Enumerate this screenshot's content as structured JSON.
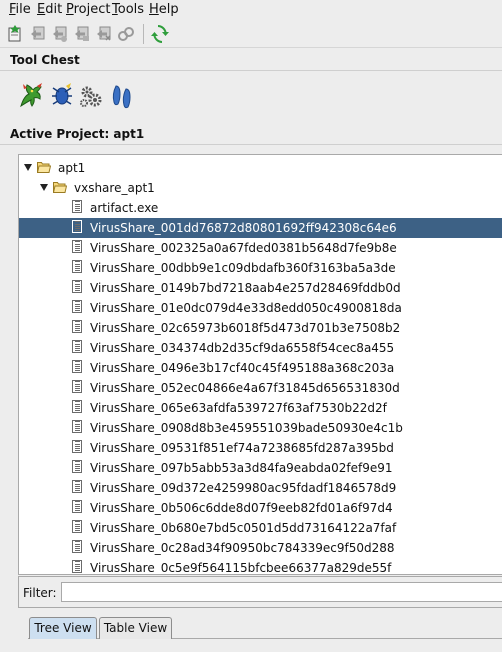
{
  "menu": {
    "items": [
      {
        "mnemonic": "F",
        "rest": "ile"
      },
      {
        "mnemonic": "E",
        "rest": "dit"
      },
      {
        "mnemonic": "P",
        "rest": "roject"
      },
      {
        "mnemonic": "T",
        "rest": "ools"
      },
      {
        "mnemonic": "H",
        "rest": "elp"
      }
    ]
  },
  "toolbar": {
    "icons": [
      "new-project-icon",
      "open-project-icon",
      "import-icon",
      "export-icon",
      "archive-icon",
      "link-icon",
      "refresh-icon"
    ]
  },
  "tool_chest": {
    "title": "Tool Chest",
    "tools": [
      "dragon-icon",
      "debugger-bug-icon",
      "version-tracking-gears-icon",
      "footprints-icon"
    ]
  },
  "project": {
    "title": "Active Project: apt1",
    "root": "apt1",
    "folder": "vxshare_apt1",
    "files": [
      "artifact.exe",
      "VirusShare_001dd76872d80801692ff942308c64e6",
      "VirusShare_002325a0a67fded0381b5648d7fe9b8e",
      "VirusShare_00dbb9e1c09dbdafb360f3163ba5a3de",
      "VirusShare_0149b7bd7218aab4e257d28469fddb0d",
      "VirusShare_01e0dc079d4e33d8edd050c4900818da",
      "VirusShare_02c65973b6018f5d473d701b3e7508b2",
      "VirusShare_034374db2d35cf9da6558f54cec8a455",
      "VirusShare_0496e3b17cf40c45f495188a368c203a",
      "VirusShare_052ec04866e4a67f31845d656531830d",
      "VirusShare_065e63afdfa539727f63af7530b22d2f",
      "VirusShare_0908d8b3e459551039bade50930e4c1b",
      "VirusShare_09531f851ef74a7238685fd287a395bd",
      "VirusShare_097b5abb53a3d84fa9eabda02fef9e91",
      "VirusShare_09d372e4259980ac95fdadf1846578d9",
      "VirusShare_0b506c6dde8d07f9eeb82fd01a6f97d4",
      "VirusShare_0b680e7bd5c0501d5dd73164122a7faf",
      "VirusShare_0c28ad34f90950bc784339ec9f50d288",
      "VirusShare_0c5e9f564115bfcbee66377a829de55f"
    ],
    "selected": "VirusShare_001dd76872d80801692ff942308c64e6"
  },
  "filter": {
    "label": "Filter:",
    "value": ""
  },
  "tabs": [
    {
      "label": "Tree View",
      "active": true
    },
    {
      "label": "Table View",
      "active": false
    }
  ]
}
